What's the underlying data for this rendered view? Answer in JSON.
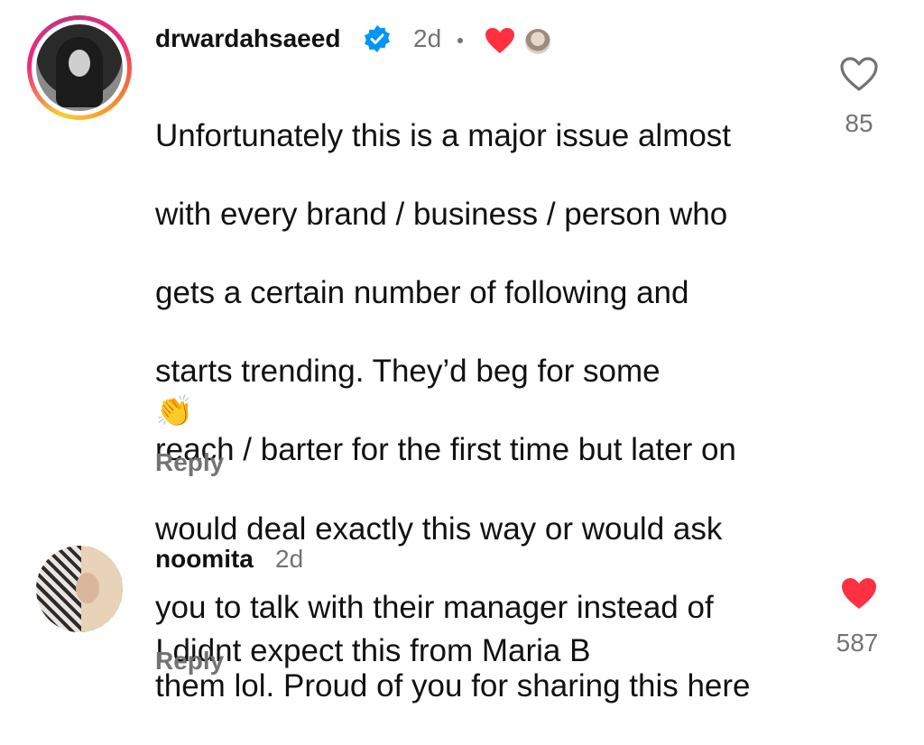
{
  "comments": [
    {
      "username": "drwardahsaeed",
      "verified": true,
      "time": "2d",
      "text_lines": [
        "Unfortunately this is a major issue almost",
        "with every brand / business / person who",
        "gets a certain number of following and",
        "starts trending. They’d beg for some",
        "reach / barter for the first time but later on",
        "would deal exactly this way or would ask",
        "you to talk with their manager instead of",
        "them lol. Proud of you for sharing this here"
      ],
      "emoji": "👏",
      "reply_label": "Reply",
      "like_count": "85",
      "liked": false,
      "creator_liked": true
    },
    {
      "username": "noomita",
      "verified": false,
      "time": "2d",
      "text_lines": [
        "I didnt expect this from Maria B"
      ],
      "reply_label": "Reply",
      "like_count": "587",
      "liked": true
    }
  ],
  "colors": {
    "like_red": "#ff3040",
    "verified_blue": "#0095f6",
    "meta_gray": "#737373",
    "text": "#111111"
  },
  "icons": {
    "verified": "verified-badge-icon",
    "like": "heart-icon",
    "creator_like": "creator-heart-icon",
    "clap": "clapping-hands-emoji"
  }
}
